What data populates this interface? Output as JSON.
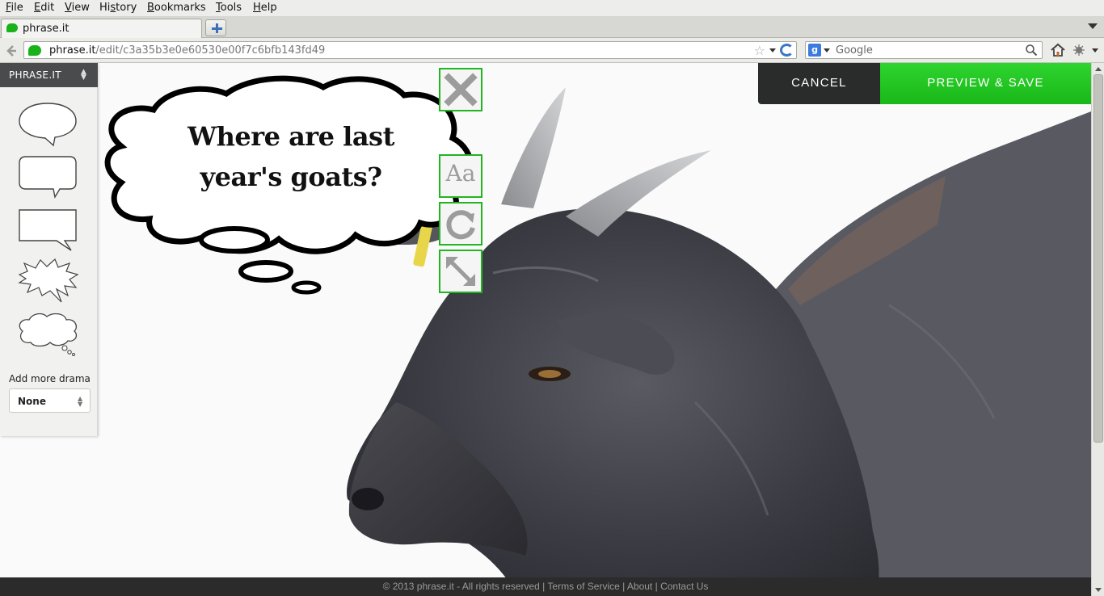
{
  "menubar": {
    "items": [
      {
        "label": "File",
        "accel": "F"
      },
      {
        "label": "Edit",
        "accel": "E"
      },
      {
        "label": "View",
        "accel": "V"
      },
      {
        "label": "History",
        "accel": "s"
      },
      {
        "label": "Bookmarks",
        "accel": "B"
      },
      {
        "label": "Tools",
        "accel": "T"
      },
      {
        "label": "Help",
        "accel": "H"
      }
    ]
  },
  "tabs": [
    {
      "title": "phrase.it",
      "active": true
    }
  ],
  "navbar": {
    "url_host": "phrase.it",
    "url_path": "/edit/c3a35b3e0e60530e00f7c6bfb143fd49",
    "search_placeholder": "Google",
    "search_engine_badge": "g"
  },
  "palette": {
    "title": "PHRASE.IT",
    "bubble_types": [
      "speech-oval",
      "speech-rounded",
      "speech-rect",
      "shout-burst",
      "thought-cloud"
    ],
    "drama_label": "Add more drama",
    "drama_value": "None"
  },
  "editor": {
    "bubble_type": "thought-cloud",
    "bubble_text_line1": "Where are last",
    "bubble_text_line2": "year's goats?",
    "tools": [
      "close-icon",
      "font-icon",
      "rotate-icon",
      "resize-icon"
    ],
    "font_tool_glyph": "Aa"
  },
  "actions": {
    "cancel": "CANCEL",
    "preview_save": "PREVIEW & SAVE"
  },
  "footer": {
    "copyright": "© 2013 phrase.it - All rights reserved",
    "sep": " | ",
    "links": [
      "Terms of Service",
      "About",
      "Contact Us"
    ]
  },
  "colors": {
    "accent_green": "#21b51f",
    "cancel_bg": "#2a2b2b",
    "footer_bg": "#2b2b2b"
  }
}
